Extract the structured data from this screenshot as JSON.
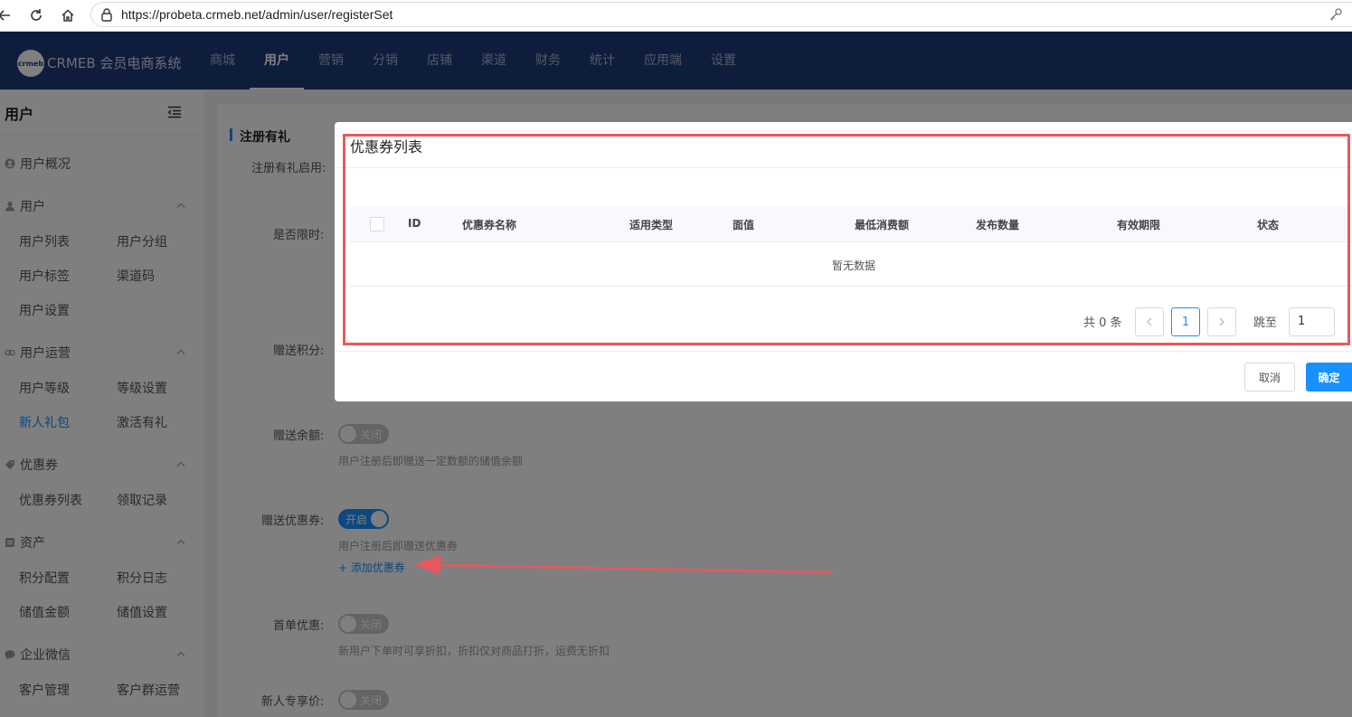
{
  "browser": {
    "url": "https://probeta.crmeb.net/admin/user/registerSet"
  },
  "header": {
    "logo_mark": "crmeb",
    "logo_text": "CRMEB 会员电商系统",
    "nav": [
      "商城",
      "用户",
      "营销",
      "分销",
      "店铺",
      "渠道",
      "财务",
      "统计",
      "应用端",
      "设置"
    ],
    "active_nav": "用户"
  },
  "sidebar": {
    "title": "用户",
    "groups": [
      {
        "label": "用户概况",
        "items": []
      },
      {
        "label": "用户",
        "items": [
          "用户列表",
          "用户分组",
          "用户标签",
          "渠道码",
          "用户设置"
        ]
      },
      {
        "label": "用户运营",
        "items": [
          "用户等级",
          "等级设置",
          "新人礼包",
          "激活有礼"
        ]
      },
      {
        "label": "优惠券",
        "items": [
          "优惠券列表",
          "领取记录"
        ]
      },
      {
        "label": "资产",
        "items": [
          "积分配置",
          "积分日志",
          "储值金额",
          "储值设置"
        ]
      },
      {
        "label": "企业微信",
        "items": [
          "客户管理",
          "客户群运营"
        ]
      }
    ],
    "active_item": "新人礼包"
  },
  "form": {
    "section_title": "注册有礼",
    "labels": {
      "enable": "注册有礼启用:",
      "time_limit": "是否限时:",
      "points": "赠送积分:",
      "balance": "赠送余额:",
      "coupon": "赠送优惠券:",
      "first_order": "首单优惠:",
      "new_price": "新人专享价:"
    },
    "switch_off": "关闭",
    "switch_on": "开启",
    "balance_hint": "用户注册后即赠送一定数额的储值余额",
    "coupon_hint": "用户注册后即赠送优惠券",
    "add_coupon": "+ 添加优惠券",
    "first_order_hint": "新用户下单时可享折扣，折扣仅对商品打折，运费无折扣"
  },
  "modal": {
    "title": "优惠券列表",
    "columns": [
      "ID",
      "优惠券名称",
      "适用类型",
      "面值",
      "最低消费额",
      "发布数量",
      "有效期限",
      "状态"
    ],
    "empty_text": "暂无数据",
    "total": "共 0 条",
    "current_page": "1",
    "jump_label": "跳至",
    "jump_value": "1",
    "cancel": "取消",
    "confirm": "确定"
  },
  "colors": {
    "primary": "#1890ff",
    "header_bg": "#1f3a7a",
    "annotation": "#e8585e"
  }
}
